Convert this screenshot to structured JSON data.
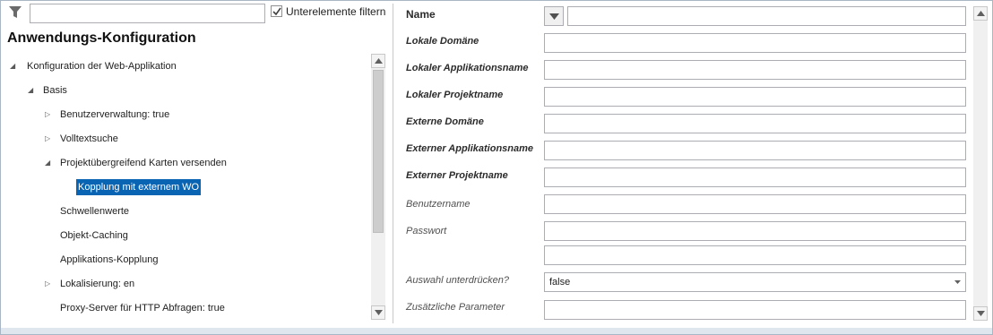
{
  "filter": {
    "input_value": "",
    "checkbox_label": "Unterelemente filtern",
    "checkbox_checked": true
  },
  "left_pane": {
    "title": "Anwendungs-Konfiguration"
  },
  "tree": {
    "nodes": [
      {
        "label": "Konfiguration der Web-Applikation",
        "level": 0,
        "expander": "expanded"
      },
      {
        "label": "Basis",
        "level": 1,
        "expander": "expanded"
      },
      {
        "label": "Benutzerverwaltung: true",
        "level": 2,
        "expander": "collapsed"
      },
      {
        "label": "Volltextsuche",
        "level": 2,
        "expander": "collapsed"
      },
      {
        "label": "Projektübergreifend Karten versenden",
        "level": 2,
        "expander": "expanded"
      },
      {
        "label": "Kopplung mit externem WO",
        "level": 3,
        "expander": "none",
        "selected": true
      },
      {
        "label": "Schwellenwerte",
        "level": 2,
        "expander": "none"
      },
      {
        "label": "Objekt-Caching",
        "level": 2,
        "expander": "none"
      },
      {
        "label": "Applikations-Kopplung",
        "level": 2,
        "expander": "none"
      },
      {
        "label": "Lokalisierung: en",
        "level": 2,
        "expander": "collapsed"
      },
      {
        "label": "Proxy-Server für HTTP Abfragen: true",
        "level": 2,
        "expander": "none"
      }
    ]
  },
  "form": {
    "name_label": "Name",
    "name_value": "",
    "fields": [
      {
        "label": "Lokale Domäne",
        "value": "",
        "style": "bold"
      },
      {
        "label": "Lokaler Applikationsname",
        "value": "",
        "style": "bold"
      },
      {
        "label": "Lokaler Projektname",
        "value": "",
        "style": "bold"
      },
      {
        "label": "Externe Domäne",
        "value": "",
        "style": "bold"
      },
      {
        "label": "Externer Applikationsname",
        "value": "",
        "style": "bold"
      },
      {
        "label": "Externer Projektname",
        "value": "",
        "style": "bold"
      },
      {
        "label": "Benutzername",
        "value": "",
        "style": "italic"
      },
      {
        "label": "Passwort",
        "value": "",
        "style": "italic"
      },
      {
        "label": "",
        "value": "",
        "style": "italic"
      }
    ],
    "auswahl_label": "Auswahl unterdrücken?",
    "auswahl_value": "false",
    "parameter_label": "Zusätzliche Parameter",
    "parameter_value": ""
  }
}
